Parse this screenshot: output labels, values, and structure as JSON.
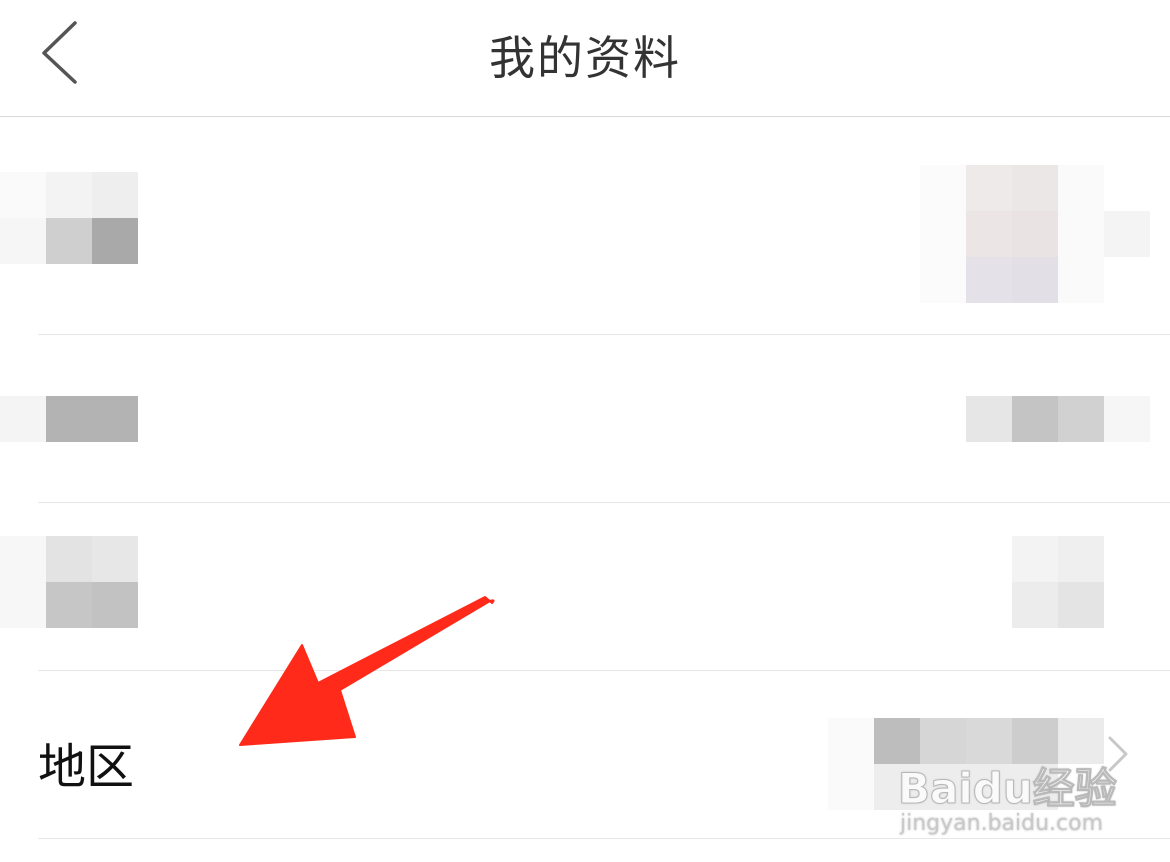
{
  "header": {
    "title": "我的资料",
    "back_icon": "chevron-left-icon"
  },
  "rows": {
    "region": {
      "label": "地区",
      "chevron_icon": "chevron-right-icon"
    }
  },
  "watermark": {
    "brand": "Baidu经验",
    "url": "jingyan.baidu.com"
  },
  "colors": {
    "annotation_arrow": "#ff2a1a",
    "divider": "#e6e6e6",
    "chevron": "#c8c8c8"
  }
}
